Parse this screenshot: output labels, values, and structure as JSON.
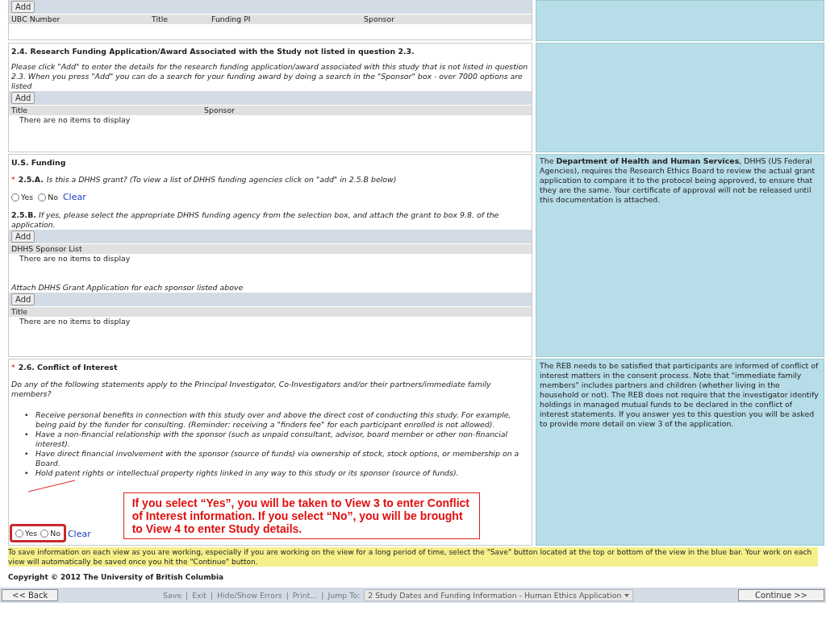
{
  "funding_table": {
    "add_button": "Add",
    "columns": [
      "UBC Number",
      "Title",
      "Funding PI",
      "Sponsor"
    ]
  },
  "unlisted_funding": {
    "heading": "2.4. Research Funding Application/Award Associated with the Study not listed in question 2.3.",
    "instructions": "Please click \"Add\" to enter the details for the research funding application/award associated with this study that is not listed in question 2.3. When you press \"Add\" you can do a search for your funding award by doing a search in the \"Sponsor\" box - over 7000 options are listed",
    "add_button": "Add",
    "columns": [
      "Title",
      "Sponsor"
    ],
    "empty_message": "There are no items to display"
  },
  "us_funding": {
    "heading": "U.S. Funding",
    "question_a": {
      "required_mark": "*",
      "number": "2.5.A.",
      "text": "Is this a DHHS grant? (To view a list of DHHS funding agencies click on \"add\" in  2.5.B below)",
      "options": [
        {
          "label": "Yes",
          "checked": false
        },
        {
          "label": "No",
          "checked": false
        }
      ],
      "clear_link": "Clear"
    },
    "question_b": {
      "number": "2.5.B.",
      "text": "If yes, please select the appropriate DHHS funding agency from the selection box, and attach the grant to box 9.8. of the application.",
      "add_button": "Add",
      "columns": [
        "DHHS Sponsor List"
      ],
      "empty_message": "There are no items to display"
    },
    "attachment": {
      "label": "Attach DHHS Grant Application for each sponsor listed above",
      "add_button": "Add",
      "columns": [
        "Title"
      ],
      "empty_message": "There are no items to display"
    },
    "help": "The **Department of Health and Human Services**, DHHS (US Federal Agencies), requires the Research Ethics Board to review the actual grant application to compare it to the protocol being approved, to ensure that they are the same. Your certificate of approval will not be released until this documentation is attached."
  },
  "conflict_of_interest": {
    "required_mark": "*",
    "heading": "2.6. Conflict of Interest",
    "question": "Do any of the following statements apply to the Principal Investigator, Co-Investigators and/or their partners/immediate family members?",
    "bullet_marker": "•",
    "bullets": [
      "Receive personal benefits in connection with this study over and above the direct cost of conducting this study. For example, being paid by the funder for consulting.  (Reminder: receiving a \"finders fee\" for each participant enrolled is not allowed).",
      "Have a non-financial relationship with the sponsor (such as unpaid consultant, advisor, board member or other non-financial interest).",
      "Have direct financial involvement with the sponsor (source of funds) via ownership of stock, stock options, or membership on a Board.",
      "Hold patent rights or intellectual property rights linked in any way to this study or its sponsor (source of funds)."
    ],
    "options": [
      {
        "label": "Yes",
        "checked": false
      },
      {
        "label": "No",
        "checked": false
      }
    ],
    "clear_link": "Clear",
    "callout": "If you select “Yes”, you will be taken to View 3 to enter Conflict of Interest information. If you select “No”, you will be brought to View 4 to enter Study details.",
    "help": "The REB needs to be satisfied that participants are informed of conflict of interest matters in the consent process.  Note that \"immediate family members\" includes partners and children (whether living in the household or not).  The REB does not require that the investigator identify holdings in managed mutual funds to be declared in the conflict of interest statements. If you answer yes to this question you will be asked to provide more detail on view 3 of the application."
  },
  "save_note": "To save information on each view as you are working, especially if you are working on the view for a long period of time, select the \"Save\" button located at the top or bottom of the view in the blue bar. Your work on each view will automatically be saved once you hit the \"Continue\" button.",
  "copyright": "Copyright © 2012 The University of British Columbia",
  "nav_bar": {
    "back_button": "<< Back",
    "links": [
      "Save",
      "Exit",
      "Hide/Show Errors",
      "Print..."
    ],
    "separator": "|",
    "jump_label": "Jump To:",
    "jump_value": "2 Study Dates and Funding Information - Human Ethics Application",
    "continue_button": "Continue >>"
  }
}
